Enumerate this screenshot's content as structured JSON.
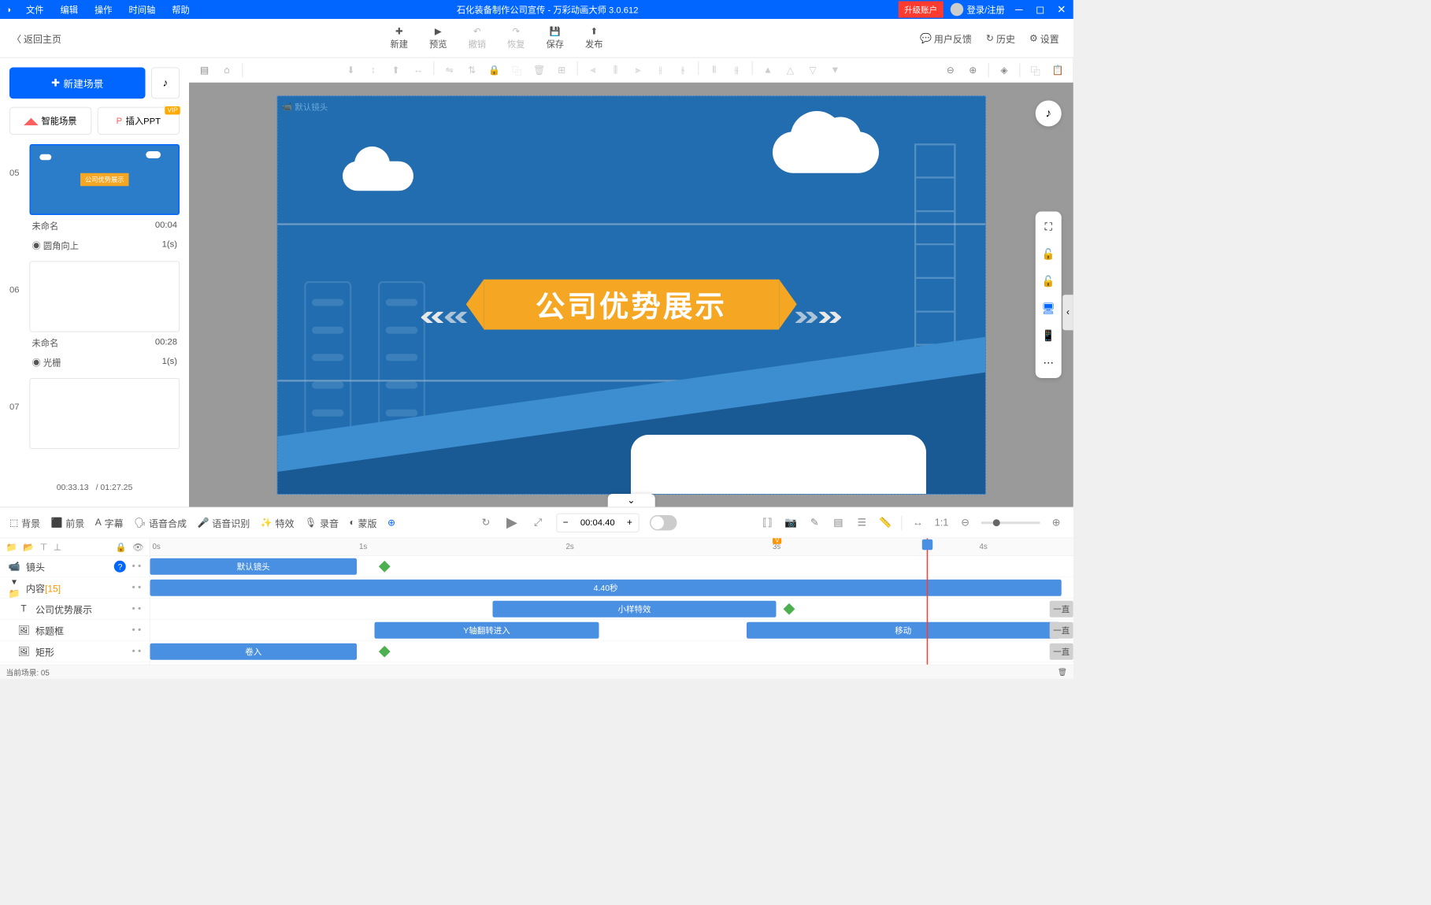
{
  "titlebar": {
    "menus": [
      "文件",
      "编辑",
      "操作",
      "时间轴",
      "帮助"
    ],
    "title": "石化装备制作公司宣传 - 万彩动画大师 3.0.612",
    "upgrade": "升级账户",
    "login": "登录/注册"
  },
  "toolbar": {
    "back": "返回主页",
    "new": "新建",
    "preview": "预览",
    "undo": "撤销",
    "redo": "恢复",
    "save": "保存",
    "publish": "发布",
    "feedback": "用户反馈",
    "history": "历史",
    "settings": "设置"
  },
  "sidebar": {
    "new_scene": "新建场景",
    "smart_scene": "智能场景",
    "insert_ppt": "插入PPT",
    "vip": "VIP",
    "scenes": [
      {
        "num": "05",
        "name": "未命名",
        "duration": "00:04",
        "transition": "圆角向上",
        "trans_time": "1(s)",
        "selected": true
      },
      {
        "num": "06",
        "name": "未命名",
        "duration": "00:28",
        "transition": "光栅",
        "trans_time": "1(s)",
        "selected": false
      },
      {
        "num": "07",
        "name": "",
        "duration": "",
        "transition": "",
        "trans_time": "",
        "selected": false
      }
    ],
    "current_time": "00:33.13",
    "total_time": "/ 01:27.25"
  },
  "canvas": {
    "camera_label": "默认镜头",
    "main_title": "公司优势展示"
  },
  "timeline": {
    "tools": {
      "bg": "背景",
      "fg": "前景",
      "subtitle": "字幕",
      "tts": "语音合成",
      "asr": "语音识别",
      "fx": "特效",
      "record": "录音",
      "mask": "蒙版"
    },
    "time_value": "00:04.40",
    "ruler": [
      "0s",
      "1s",
      "2s",
      "3s",
      "4s"
    ],
    "tracks": {
      "camera": {
        "label": "镜头",
        "clip": "默认镜头"
      },
      "content": {
        "label": "内容",
        "count": "[15]",
        "clip": "4.40秒"
      },
      "text": {
        "label": "公司优势展示",
        "clip": "小样特效"
      },
      "titlebox": {
        "label": "标题框",
        "clip1": "Y轴翻转进入",
        "clip2": "移动"
      },
      "rect": {
        "label": "矩形",
        "clip": "卷入"
      },
      "always": "一直"
    },
    "vip_mark": "V"
  },
  "status": {
    "current_scene": "当前场景: 05"
  }
}
